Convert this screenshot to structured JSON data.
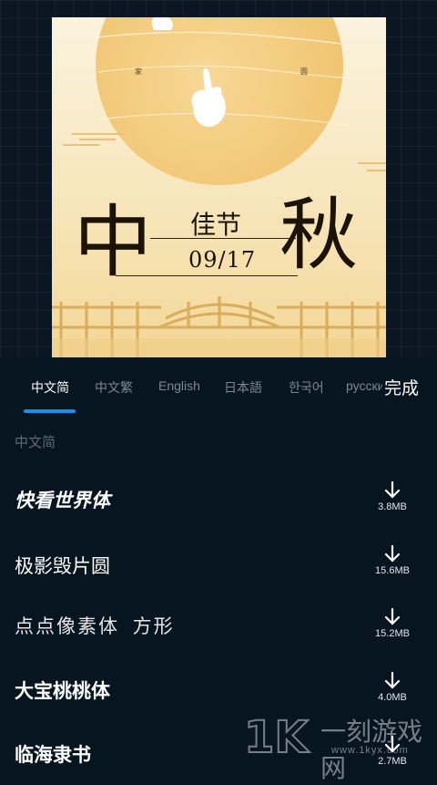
{
  "poster": {
    "left_label": "家",
    "right_label": "圆",
    "char_left": "中",
    "char_right": "秋",
    "subtitle": "佳节",
    "date": "09/17"
  },
  "tabs": [
    {
      "label": "中文简",
      "active": true
    },
    {
      "label": "中文繁",
      "active": false
    },
    {
      "label": "English",
      "active": false
    },
    {
      "label": "日本語",
      "active": false
    },
    {
      "label": "한국어",
      "active": false
    },
    {
      "label": "русски",
      "active": false
    }
  ],
  "done_label": "完成",
  "section_title": "中文简",
  "fonts": [
    {
      "name": "快看世界体",
      "size": "3.8MB"
    },
    {
      "name": "极影毁片圆",
      "size": "15.6MB"
    },
    {
      "name": "点点像素体 方形",
      "size": "15.2MB"
    },
    {
      "name": "大宝桃桃体",
      "size": "4.0MB"
    },
    {
      "name": "临海隶书",
      "size": "2.7MB"
    }
  ],
  "watermark": {
    "text": "一刻游戏网",
    "url": "www.1kyx.com"
  },
  "colors": {
    "accent": "#1e8ee8",
    "background": "#071521"
  }
}
